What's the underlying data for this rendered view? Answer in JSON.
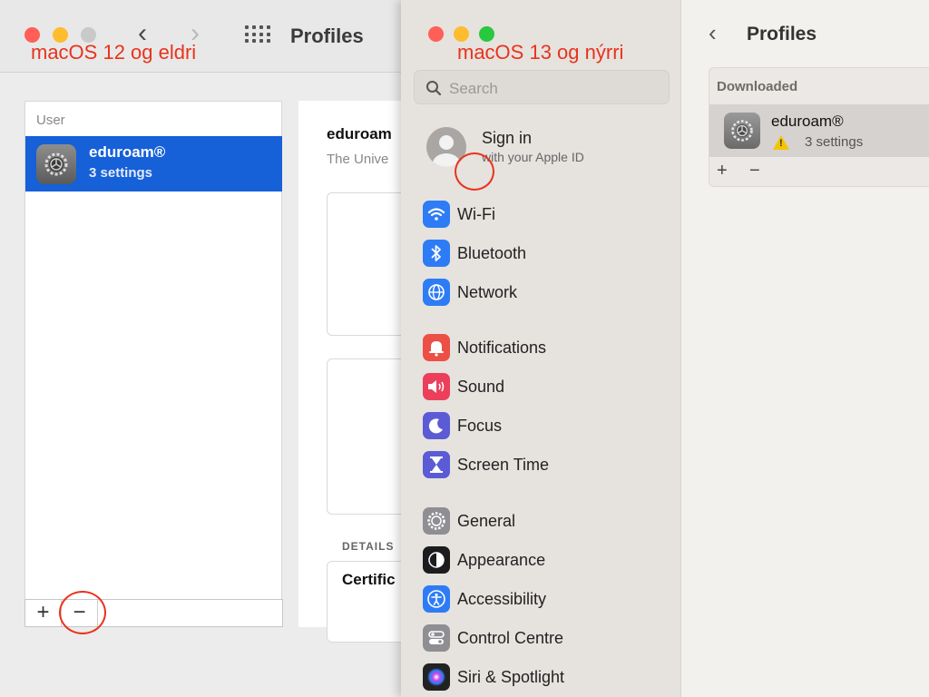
{
  "old_window": {
    "title": "Profiles",
    "annotation": "macOS 12 og eldri",
    "nav_back": "‹",
    "nav_forward": "›",
    "sidebar": {
      "section": "User",
      "profile_name": "eduroam®",
      "profile_sub": "3 settings"
    },
    "add_label": "+",
    "remove_label": "−",
    "detail": {
      "title": "eduroam",
      "subtitle": "The Unive",
      "details_header": "DETAILS",
      "cert_label": "Certific"
    }
  },
  "new_window": {
    "annotation": "macOS 13 og nýrri",
    "search_placeholder": "Search",
    "sign_in": {
      "title": "Sign in",
      "subtitle": "with your Apple ID"
    },
    "nav_items": [
      {
        "label": "Wi-Fi",
        "icon": "wifi-icon",
        "color": "#2d7cf6"
      },
      {
        "label": "Bluetooth",
        "icon": "bluetooth-icon",
        "color": "#2d7cf6"
      },
      {
        "label": "Network",
        "icon": "globe-icon",
        "color": "#2d7cf6"
      },
      {
        "label": "Notifications",
        "icon": "bell-icon",
        "color": "#ec4f46"
      },
      {
        "label": "Sound",
        "icon": "speaker-icon",
        "color": "#ec3f5c"
      },
      {
        "label": "Focus",
        "icon": "moon-icon",
        "color": "#5b5bd6"
      },
      {
        "label": "Screen Time",
        "icon": "hourglass-icon",
        "color": "#5b5bd6"
      },
      {
        "label": "General",
        "icon": "gear-icon",
        "color": "#8e8e93"
      },
      {
        "label": "Appearance",
        "icon": "appearance-icon",
        "color": "#1c1c1e"
      },
      {
        "label": "Accessibility",
        "icon": "accessibility-icon",
        "color": "#2d7cf6"
      },
      {
        "label": "Control Centre",
        "icon": "toggles-icon",
        "color": "#8e8e93"
      },
      {
        "label": "Siri & Spotlight",
        "icon": "siri-icon",
        "color": "#222"
      }
    ],
    "main": {
      "back": "‹",
      "title": "Profiles",
      "group_header": "Downloaded",
      "profile_name": "eduroam®",
      "profile_sub": "3 settings",
      "add_label": "+",
      "remove_label": "−"
    }
  }
}
